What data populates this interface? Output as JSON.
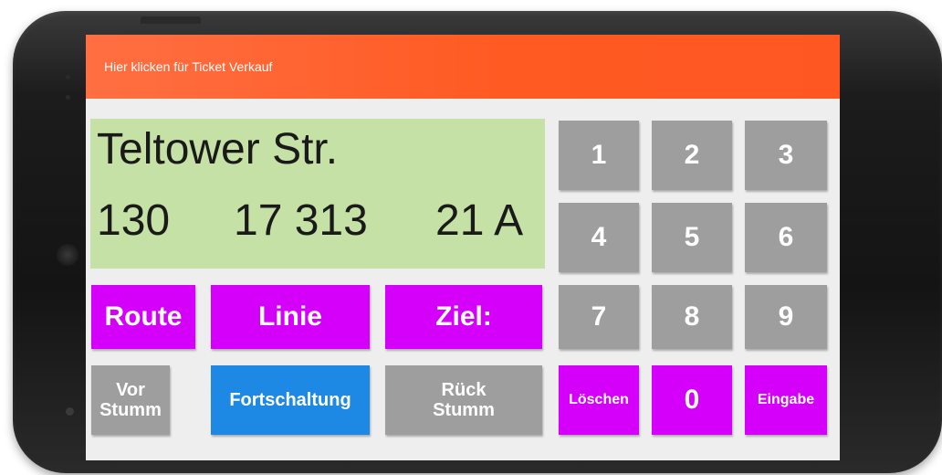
{
  "top_bar": {
    "label": "Hier klicken für Ticket Verkauf"
  },
  "display": {
    "stop_name": "Teltower Str.",
    "route": "130",
    "line": "17 313",
    "destination": "21 A"
  },
  "buttons": {
    "route": "Route",
    "line": "Linie",
    "destination": "Ziel:",
    "prev_mute": "Vor\nStumm",
    "advance": "Fortschaltung",
    "back_mute": "Rück\nStumm",
    "clear": "Löschen",
    "enter": "Eingabe"
  },
  "keypad": [
    "1",
    "2",
    "3",
    "4",
    "5",
    "6",
    "7",
    "8",
    "9",
    "0"
  ],
  "colors": {
    "top_bar": "#ff5722",
    "display_bg": "#c5e1a5",
    "key_gray": "#9e9e9e",
    "key_magenta": "#d500f9",
    "key_blue": "#1e88e5"
  }
}
